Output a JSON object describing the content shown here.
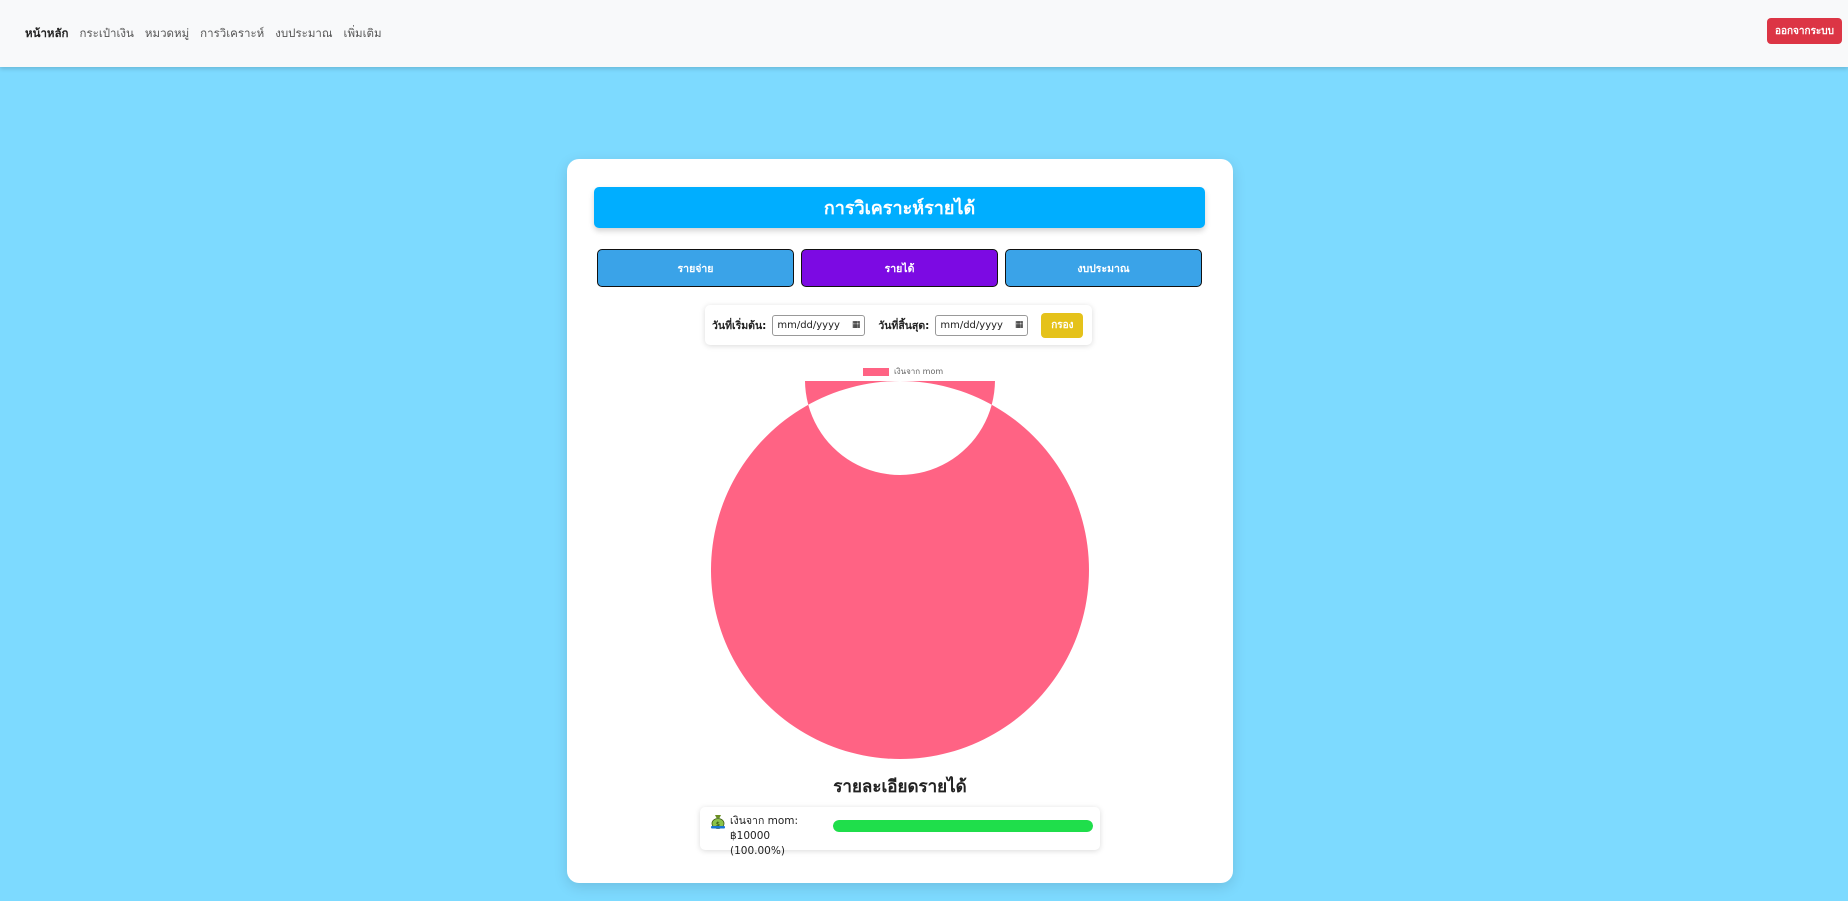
{
  "nav": {
    "items": [
      {
        "label": "หน้าหลัก",
        "active": true
      },
      {
        "label": "กระเป๋าเงิน",
        "active": false
      },
      {
        "label": "หมวดหมู่",
        "active": false
      },
      {
        "label": "การวิเคราะห์",
        "active": false
      },
      {
        "label": "งบประมาณ",
        "active": false
      },
      {
        "label": "เพิ่มเติม",
        "active": false
      }
    ],
    "logout_label": "ออกจากระบบ"
  },
  "card": {
    "title": "การวิเคราะห์รายได้",
    "tabs": [
      {
        "label": "รายจ่าย",
        "active": false
      },
      {
        "label": "รายได้",
        "active": true
      },
      {
        "label": "งบประมาณ",
        "active": false
      }
    ]
  },
  "filter": {
    "start_label": "วันที่เริ่มต้น:",
    "end_label": "วันที่สิ้นสุด:",
    "start_placeholder": "mm/dd/yyyy",
    "end_placeholder": "mm/dd/yyyy",
    "button_label": "กรอง"
  },
  "chart_data": {
    "type": "pie",
    "variant": "doughnut",
    "categories": [
      "เงินจาก mom"
    ],
    "values": [
      10000
    ],
    "colors": [
      "#ff6384"
    ],
    "legend": "top"
  },
  "details": {
    "title": "รายละเอียดรายได้",
    "items": [
      {
        "name": "เงินจาก mom",
        "text": "เงินจาก mom: ฿10000",
        "percent_text": "(100.00%)",
        "percent": 100,
        "icon": "money-bag-icon",
        "bar_color": "#1fde4b"
      }
    ]
  },
  "colors": {
    "background": "#7ddaff",
    "header": "#00aeff",
    "tab": "#3aa3e8",
    "tab_active": "#7c0ae3",
    "logout": "#dc3545",
    "filter_button": "#e5c21a"
  }
}
